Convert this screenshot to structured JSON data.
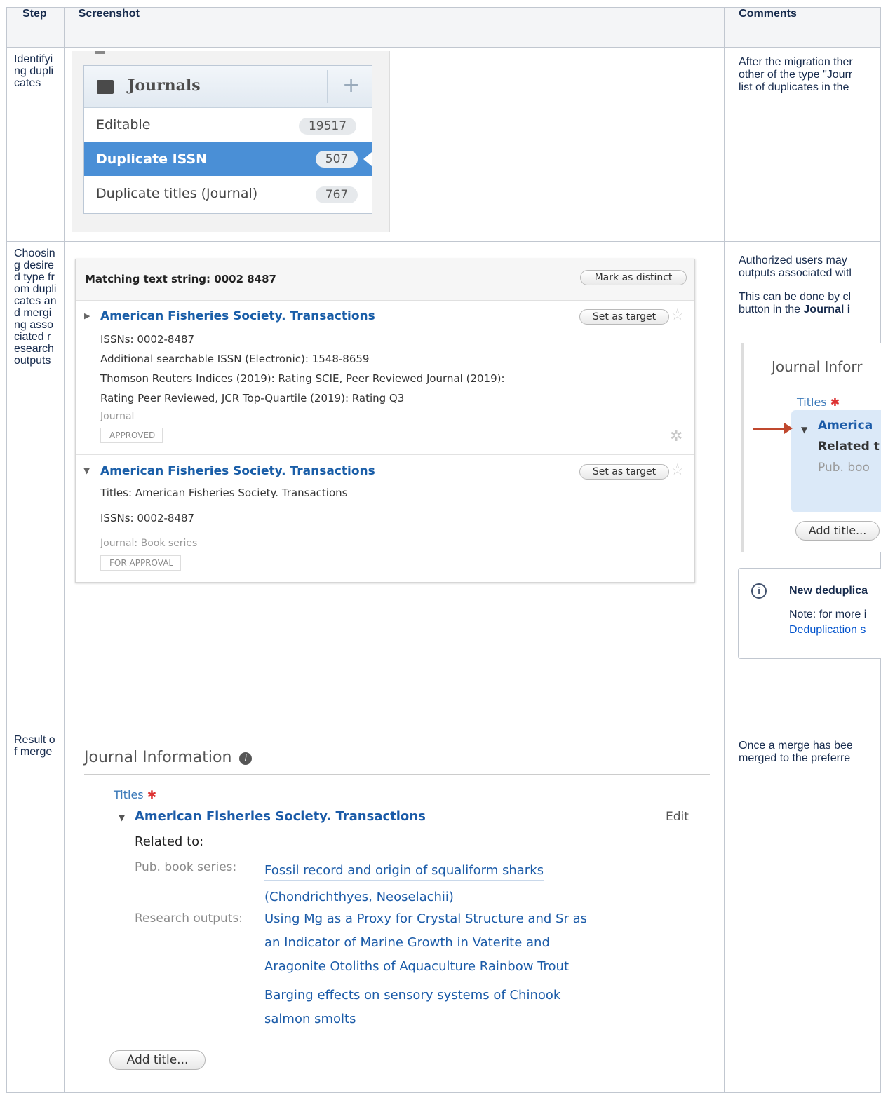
{
  "table": {
    "headers": {
      "step": "Step",
      "screenshot": "Screenshot",
      "comments": "Comments"
    },
    "rows": [
      {
        "step": "Identifying duplicates"
      },
      {
        "step": "Choosing desired type from duplicates and merging associated research outputs"
      },
      {
        "step": "Result of merge"
      }
    ]
  },
  "row1": {
    "journals_title": "Journals",
    "items": [
      {
        "label": "Editable",
        "count": "19517"
      },
      {
        "label": "Duplicate ISSN",
        "count": "507"
      },
      {
        "label": "Duplicate titles (Journal)",
        "count": "767"
      }
    ],
    "comment_lines": [
      "After the migration ther",
      "other of the type \"Jourr",
      "list of duplicates in the"
    ]
  },
  "row2": {
    "matching_label": "Matching text string: 0002 8487",
    "mark_distinct": "Mark as distinct",
    "set_target": "Set as target",
    "entry1": {
      "title": "American Fisheries Society. Transactions",
      "lines": [
        "ISSNs: 0002-8487",
        "Additional searchable ISSN (Electronic): 1548-8659",
        "Thomson Reuters Indices (2019): Rating SCIE, Peer Reviewed Journal (2019):",
        "Rating Peer Reviewed, JCR Top-Quartile (2019): Rating Q3"
      ],
      "type": "Journal",
      "status": "APPROVED"
    },
    "entry2": {
      "title": "American Fisheries Society. Transactions",
      "lines": [
        "Titles: American Fisheries Society. Transactions",
        "ISSNs: 0002-8487"
      ],
      "type": "Journal: Book series",
      "status": "FOR APPROVAL"
    },
    "comment_p1": [
      "Authorized users may",
      "outputs associated witl"
    ],
    "comment_p2_plain": "This can be done by cl",
    "comment_p2_line2": "button in the ",
    "comment_p2_bold": "Journal i",
    "mini": {
      "heading": "Journal Inforr",
      "titles_label": "Titles",
      "title": "America",
      "related": "Related t",
      "pub": "Pub. boo",
      "add_title": "Add title..."
    },
    "info": {
      "title": "New deduplica",
      "note": "Note: for more i",
      "link": "Deduplication s"
    }
  },
  "row3": {
    "heading": "Journal Information",
    "titles_label": "Titles",
    "title": "American Fisheries Society. Transactions",
    "edit": "Edit",
    "related_to": "Related to:",
    "pub_label": "Pub. book series:",
    "pub_lines": [
      "Fossil record and origin of squaliform sharks",
      "(Chondrichthyes, Neoselachii)"
    ],
    "research_label": "Research outputs:",
    "research1": [
      "Using Mg as a Proxy for Crystal Structure and Sr as",
      "an Indicator of Marine Growth in Vaterite and",
      "Aragonite Otoliths of Aquaculture Rainbow Trout"
    ],
    "research2": [
      "Barging effects on sensory systems of Chinook",
      "salmon smolts"
    ],
    "add_title": "Add title...",
    "comment_lines": [
      "Once a merge has bee",
      "merged to the preferre"
    ]
  }
}
